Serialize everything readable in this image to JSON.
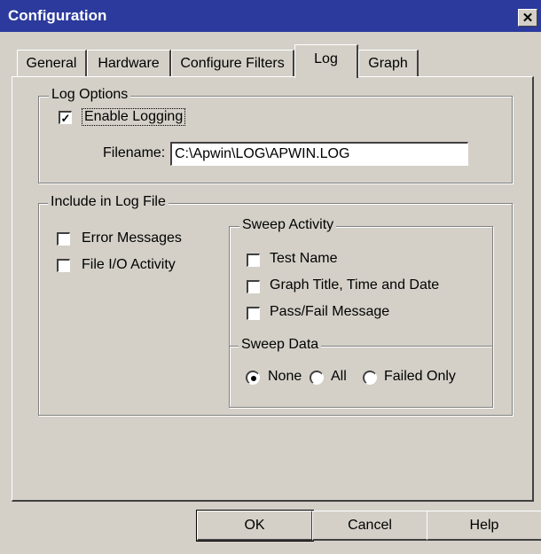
{
  "window": {
    "title": "Configuration",
    "close_glyph": "✕"
  },
  "tabs": [
    {
      "label": "General",
      "active": false
    },
    {
      "label": "Hardware",
      "active": false
    },
    {
      "label": "Configure Filters",
      "active": false
    },
    {
      "label": "Log",
      "active": true
    },
    {
      "label": "Graph",
      "active": false
    }
  ],
  "log_options": {
    "legend": "Log Options",
    "enable_logging": {
      "label": "Enable Logging",
      "checked": true
    },
    "filename": {
      "label": "Filename:",
      "value": "C:\\Apwin\\LOG\\APWIN.LOG"
    }
  },
  "include": {
    "legend": "Include in Log File",
    "error_messages": {
      "label": "Error Messages",
      "checked": false
    },
    "file_io": {
      "label": "File I/O Activity",
      "checked": false
    },
    "sweep_activity": {
      "legend": "Sweep Activity",
      "test_name": {
        "label": "Test Name",
        "checked": false
      },
      "graph_title": {
        "label": "Graph Title, Time and Date",
        "checked": false
      },
      "pass_fail": {
        "label": "Pass/Fail Message",
        "checked": false
      }
    },
    "sweep_data": {
      "legend": "Sweep Data",
      "options": [
        "None",
        "All",
        "Failed Only"
      ],
      "selected": "None",
      "none_label": "Nonе"
    }
  },
  "buttons": {
    "ok": "OK",
    "cancel": "Cancel",
    "help": "Help"
  },
  "colors": {
    "titlebar": "#2b3a9c",
    "face": "#d4d0c8"
  }
}
